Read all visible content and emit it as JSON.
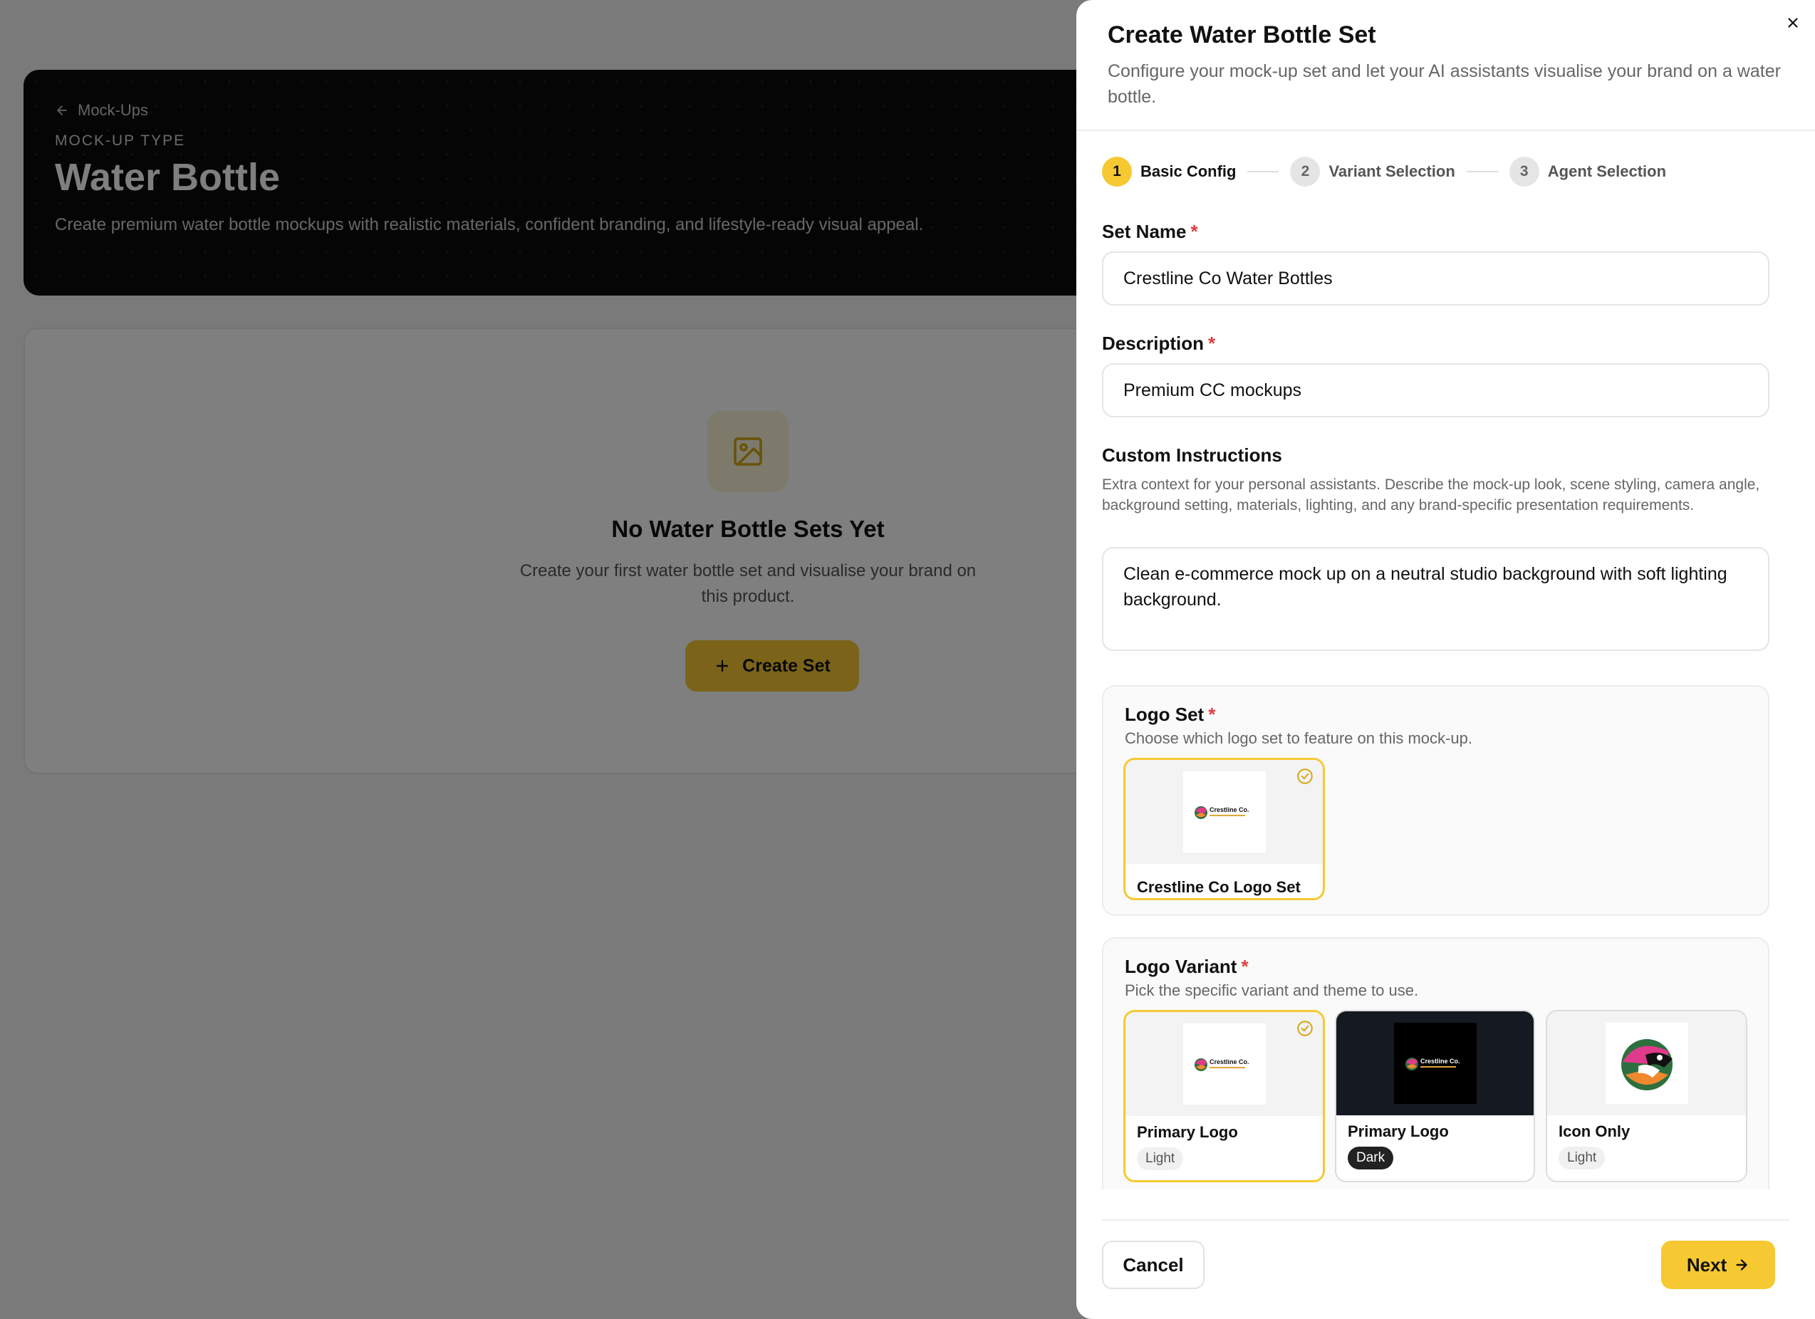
{
  "background": {
    "back_link": "Mock-Ups",
    "type_label": "MOCK-UP TYPE",
    "title": "Water Bottle",
    "description": "Create premium water bottle mockups with realistic materials, confident branding, and lifestyle-ready visual appeal.",
    "empty_title": "No Water Bottle Sets Yet",
    "empty_description": "Create your first water bottle set and visualise your brand on this product.",
    "create_button": "Create Set"
  },
  "drawer": {
    "title": "Create Water Bottle Set",
    "subtitle": "Configure your mock-up set and let your AI assistants visualise your brand on a water bottle.",
    "steps": [
      {
        "num": "1",
        "label": "Basic Config"
      },
      {
        "num": "2",
        "label": "Variant Selection"
      },
      {
        "num": "3",
        "label": "Agent Selection"
      }
    ],
    "set_name": {
      "label": "Set Name",
      "value": "Crestline Co Water Bottles"
    },
    "description": {
      "label": "Description",
      "value": "Premium CC mockups"
    },
    "custom_instructions": {
      "label": "Custom Instructions",
      "help": "Extra context for your personal assistants. Describe the mock-up look, scene styling, camera angle, background setting, materials, lighting, and any brand-specific presentation requirements.",
      "value": "Clean e-commerce mock up on a neutral studio background with soft lighting background."
    },
    "required_mark": "*",
    "logo_set": {
      "title": "Logo Set",
      "subtitle": "Choose which logo set to feature on this mock-up.",
      "options": [
        {
          "label": "Crestline Co Logo Set"
        }
      ]
    },
    "logo_variant": {
      "title": "Logo Variant",
      "subtitle": "Pick the specific variant and theme to use.",
      "options": [
        {
          "label": "Primary Logo",
          "theme": "Light"
        },
        {
          "label": "Primary Logo",
          "theme": "Dark"
        },
        {
          "label": "Icon Only",
          "theme": "Light"
        }
      ]
    },
    "logo_text": "Crestline Co.",
    "cancel": "Cancel",
    "next": "Next"
  },
  "colors": {
    "accent": "#f6c932",
    "required": "#e23b3b"
  }
}
